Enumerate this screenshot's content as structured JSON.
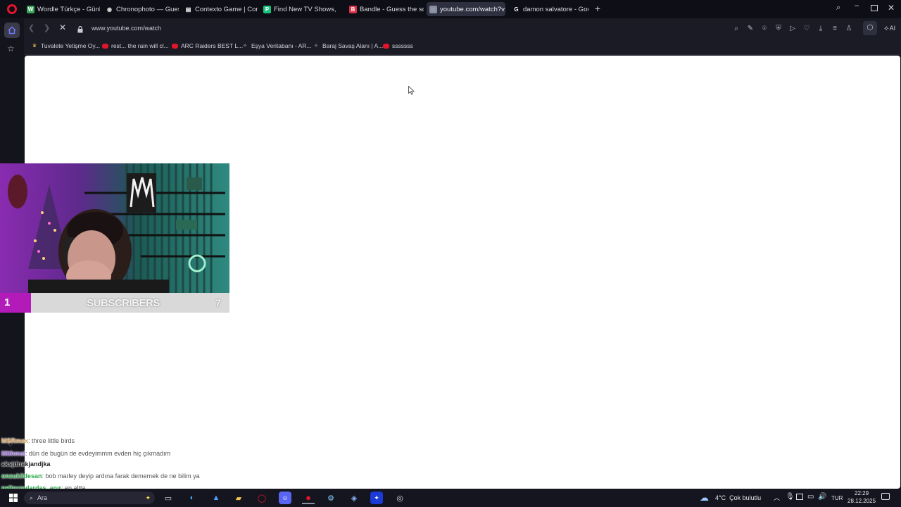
{
  "tabs": [
    {
      "label": "Wordle Türkçe - Günlük K",
      "icon": "wordle-icon",
      "color": "#3aa35a",
      "glyph": "W"
    },
    {
      "label": "Chronophoto — Guess the",
      "icon": "camera-icon",
      "color": "#dcdcdc",
      "glyph": "◉"
    },
    {
      "label": "Contexto Game | Contexto",
      "icon": "contexto-icon",
      "color": "#ffffff",
      "glyph": "▤"
    },
    {
      "label": "Find New TV Shows, Movi",
      "icon": "justwatch-icon",
      "color": "#19c37d",
      "glyph": "P"
    },
    {
      "label": "Bandle - Guess the song,",
      "icon": "bandle-icon",
      "color": "#d9324a",
      "glyph": "B"
    },
    {
      "label": "youtube.com/watch?v=La",
      "icon": "loading-spinner-icon",
      "color": "#8a8fa0",
      "glyph": "◌"
    },
    {
      "label": "damon salvatore - Google",
      "icon": "google-icon",
      "color": "#ffffff",
      "glyph": "G"
    }
  ],
  "address": {
    "url": "www.youtube.com/watch"
  },
  "toolbar": {
    "ai_label": "AI"
  },
  "bookmarks": [
    {
      "label": "Tuvalete Yetişme Oy...",
      "icon": "trophy-icon"
    },
    {
      "label": "rest... the rain will cl...",
      "icon": "youtube-icon"
    },
    {
      "label": "ARC Raiders BEST L...",
      "icon": "youtube-icon"
    },
    {
      "label": "Eşya Veritabanı - AR...",
      "icon": "arc-raiders-icon"
    },
    {
      "label": "Baraj Savaş Alanı | A...",
      "icon": "arc-raiders-icon"
    },
    {
      "label": "sssssss",
      "icon": "youtube-icon"
    }
  ],
  "overlay": {
    "sub_left": "1",
    "sub_label": "SUBSCRIBERS",
    "sub_right": "7",
    "accent": "#b21bb8"
  },
  "chat": [
    {
      "user": "MSRmax",
      "user_color": "#d4a05a",
      "text": ": three little birds"
    },
    {
      "user": "lilithmai",
      "user_color": "#9b6bd6",
      "text": ": dün de bugün de evdeyimmm evden hiç çıkmadım"
    },
    {
      "user": "aksjdnakjandjka",
      "user_color": "#222222",
      "text": ""
    },
    {
      "user": "onsukildesan",
      "user_color": "#2aa84a",
      "text": ": bob marley deyip ardına farak dememek de ne bilim ya"
    },
    {
      "user": "pelinyoulardaş_anır",
      "user_color": "#2aa84a",
      "text": ": en altta"
    },
    {
      "user": "blendfigner",
      "user_color": "#3a7bd5",
      "text": ": three little birds"
    }
  ],
  "taskbar": {
    "search_label": "Ara",
    "weather": "4°C  Çok bulutlu",
    "lang": "TUR",
    "time": "22:29",
    "date": "28.12.2025"
  }
}
